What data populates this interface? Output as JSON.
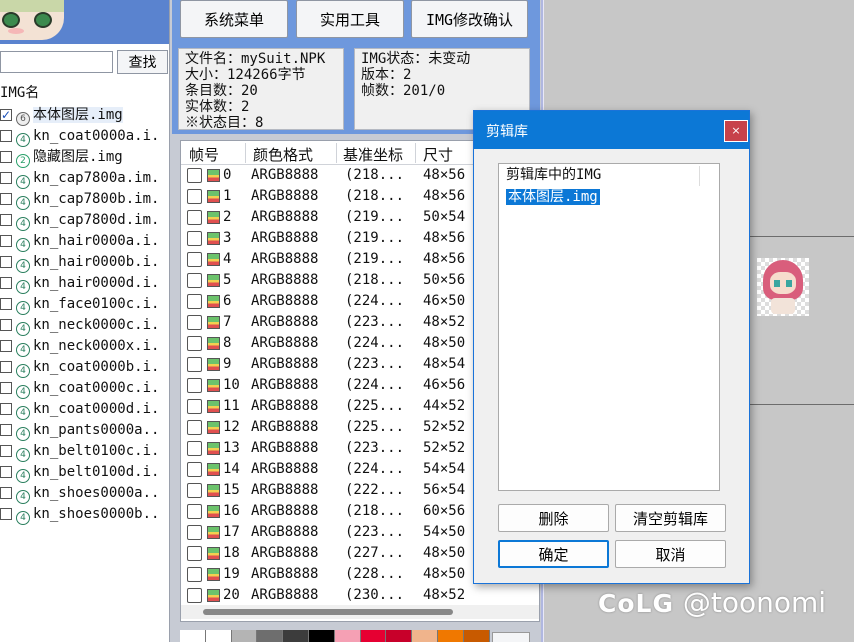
{
  "search": {
    "value": "",
    "button": "查找"
  },
  "img_list": {
    "header": "IMG名",
    "items": [
      {
        "label": "本体图层.img",
        "checked": true,
        "icon": "v6",
        "glyph": "6"
      },
      {
        "label": "kn_coat0000a.i.",
        "checked": false,
        "icon": "v4",
        "glyph": "4"
      },
      {
        "label": "隐藏图层.img",
        "checked": false,
        "icon": "v2",
        "glyph": "2"
      },
      {
        "label": "kn_cap7800a.im.",
        "checked": false,
        "icon": "v4",
        "glyph": "4"
      },
      {
        "label": "kn_cap7800b.im.",
        "checked": false,
        "icon": "v4",
        "glyph": "4"
      },
      {
        "label": "kn_cap7800d.im.",
        "checked": false,
        "icon": "v4",
        "glyph": "4"
      },
      {
        "label": "kn_hair0000a.i.",
        "checked": false,
        "icon": "v4",
        "glyph": "4"
      },
      {
        "label": "kn_hair0000b.i.",
        "checked": false,
        "icon": "v4",
        "glyph": "4"
      },
      {
        "label": "kn_hair0000d.i.",
        "checked": false,
        "icon": "v4",
        "glyph": "4"
      },
      {
        "label": "kn_face0100c.i.",
        "checked": false,
        "icon": "v4",
        "glyph": "4"
      },
      {
        "label": "kn_neck0000c.i.",
        "checked": false,
        "icon": "v4",
        "glyph": "4"
      },
      {
        "label": "kn_neck0000x.i.",
        "checked": false,
        "icon": "v4",
        "glyph": "4"
      },
      {
        "label": "kn_coat0000b.i.",
        "checked": false,
        "icon": "v4",
        "glyph": "4"
      },
      {
        "label": "kn_coat0000c.i.",
        "checked": false,
        "icon": "v4",
        "glyph": "4"
      },
      {
        "label": "kn_coat0000d.i.",
        "checked": false,
        "icon": "v4",
        "glyph": "4"
      },
      {
        "label": "kn_pants0000a..",
        "checked": false,
        "icon": "v4",
        "glyph": "4"
      },
      {
        "label": "kn_belt0100c.i.",
        "checked": false,
        "icon": "v4",
        "glyph": "4"
      },
      {
        "label": "kn_belt0100d.i.",
        "checked": false,
        "icon": "v4",
        "glyph": "4"
      },
      {
        "label": "kn_shoes0000a..",
        "checked": false,
        "icon": "v4",
        "glyph": "4"
      },
      {
        "label": "kn_shoes0000b..",
        "checked": false,
        "icon": "v4",
        "glyph": "4"
      }
    ]
  },
  "toolbar": {
    "system_menu": "系统菜单",
    "tools": "实用工具",
    "img_confirm": "IMG修改确认"
  },
  "npk_info": {
    "filename": "文件名：mySuit.NPK",
    "size": "大小：124266字节",
    "entries": "条目数：20",
    "entities": "实体数：2",
    "cut_off": "※状态目：8"
  },
  "img_info": {
    "status": "IMG状态：未变动",
    "version": "版本：2",
    "frames": "帧数：201/0"
  },
  "frame_table": {
    "headers": [
      "帧号",
      "颜色格式",
      "基准坐标",
      "尺寸"
    ],
    "rows": [
      {
        "id": "0",
        "format": "ARGB8888",
        "coord": "(218...",
        "size": "48×56"
      },
      {
        "id": "1",
        "format": "ARGB8888",
        "coord": "(218...",
        "size": "48×56"
      },
      {
        "id": "2",
        "format": "ARGB8888",
        "coord": "(219...",
        "size": "50×54"
      },
      {
        "id": "3",
        "format": "ARGB8888",
        "coord": "(219...",
        "size": "48×56"
      },
      {
        "id": "4",
        "format": "ARGB8888",
        "coord": "(219...",
        "size": "48×56"
      },
      {
        "id": "5",
        "format": "ARGB8888",
        "coord": "(218...",
        "size": "50×56"
      },
      {
        "id": "6",
        "format": "ARGB8888",
        "coord": "(224...",
        "size": "46×50"
      },
      {
        "id": "7",
        "format": "ARGB8888",
        "coord": "(223...",
        "size": "48×52"
      },
      {
        "id": "8",
        "format": "ARGB8888",
        "coord": "(224...",
        "size": "48×50"
      },
      {
        "id": "9",
        "format": "ARGB8888",
        "coord": "(223...",
        "size": "48×54"
      },
      {
        "id": "10",
        "format": "ARGB8888",
        "coord": "(224...",
        "size": "46×56"
      },
      {
        "id": "11",
        "format": "ARGB8888",
        "coord": "(225...",
        "size": "44×52"
      },
      {
        "id": "12",
        "format": "ARGB8888",
        "coord": "(225...",
        "size": "52×52"
      },
      {
        "id": "13",
        "format": "ARGB8888",
        "coord": "(223...",
        "size": "52×52"
      },
      {
        "id": "14",
        "format": "ARGB8888",
        "coord": "(224...",
        "size": "54×54"
      },
      {
        "id": "15",
        "format": "ARGB8888",
        "coord": "(222...",
        "size": "56×54"
      },
      {
        "id": "16",
        "format": "ARGB8888",
        "coord": "(218...",
        "size": "60×56"
      },
      {
        "id": "17",
        "format": "ARGB8888",
        "coord": "(223...",
        "size": "54×50"
      },
      {
        "id": "18",
        "format": "ARGB8888",
        "coord": "(227...",
        "size": "48×50"
      },
      {
        "id": "19",
        "format": "ARGB8888",
        "coord": "(228...",
        "size": "48×50"
      },
      {
        "id": "20",
        "format": "ARGB8888",
        "coord": "(230...",
        "size": "48×52"
      }
    ]
  },
  "palette": [
    "#ffffff",
    "#ffffff",
    "#b4b4b4",
    "#6e6e6e",
    "#3c3c3c",
    "#000000",
    "#f5a0b4",
    "#e60032",
    "#c8002a",
    "#f0b48c",
    "#f07800",
    "#c85a00"
  ],
  "dialog": {
    "title": "剪辑库",
    "close": "×",
    "list": [
      "剪辑库中的IMG",
      "本体图层.img"
    ],
    "delete": "删除",
    "clear": "清空剪辑库",
    "ok": "确定",
    "cancel": "取消"
  },
  "watermark": {
    "logo": "CoLG",
    "handle": "@toonomi"
  }
}
